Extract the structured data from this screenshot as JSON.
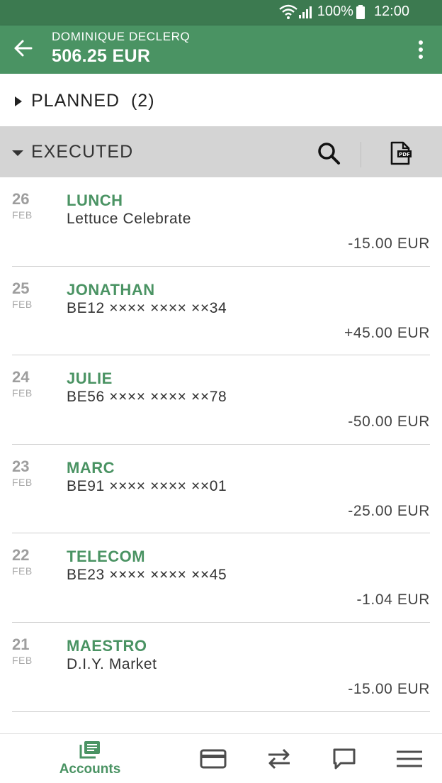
{
  "status_bar": {
    "battery": "100%",
    "time": "12:00",
    "icons": [
      "wifi-icon",
      "signal-icon",
      "battery-icon"
    ]
  },
  "header": {
    "account_holder": "DOMINIQUE DECLERQ",
    "balance": "506.25 EUR",
    "back_icon": "arrow-left-icon",
    "more_icon": "more-vertical-icon"
  },
  "planned": {
    "label": "PLANNED  (2)",
    "expanded": false
  },
  "executed": {
    "label": "EXECUTED",
    "expanded": true,
    "search_icon": "search-icon",
    "pdf_icon": "pdf-export-icon"
  },
  "transactions": [
    {
      "day": "26",
      "month": "FEB",
      "name": "LUNCH",
      "description": "Lettuce Celebrate",
      "amount": "-15.00 EUR"
    },
    {
      "day": "25",
      "month": "FEB",
      "name": "JONATHAN",
      "description": "BE12 ×××× ×××× ××34",
      "amount": "+45.00 EUR"
    },
    {
      "day": "24",
      "month": "FEB",
      "name": "JULIE",
      "description": "BE56 ×××× ×××× ××78",
      "amount": "-50.00 EUR"
    },
    {
      "day": "23",
      "month": "FEB",
      "name": "MARC",
      "description": "BE91 ×××× ×××× ××01",
      "amount": "-25.00 EUR"
    },
    {
      "day": "22",
      "month": "FEB",
      "name": "TELECOM",
      "description": "BE23 ×××× ×××× ××45",
      "amount": "-1.04 EUR"
    },
    {
      "day": "21",
      "month": "FEB",
      "name": "MAESTRO",
      "description": "D.I.Y. Market",
      "amount": "-15.00 EUR"
    }
  ],
  "bottom_nav": {
    "accounts_label": "Accounts",
    "items": [
      "accounts-icon",
      "card-icon",
      "transfer-icon",
      "messages-icon",
      "menu-icon"
    ],
    "active": "Accounts"
  },
  "colors": {
    "status_bar": "#3c7a50",
    "app_bar": "#4a9363",
    "accent": "#4a9363",
    "section_bar": "#d4d4d4"
  }
}
